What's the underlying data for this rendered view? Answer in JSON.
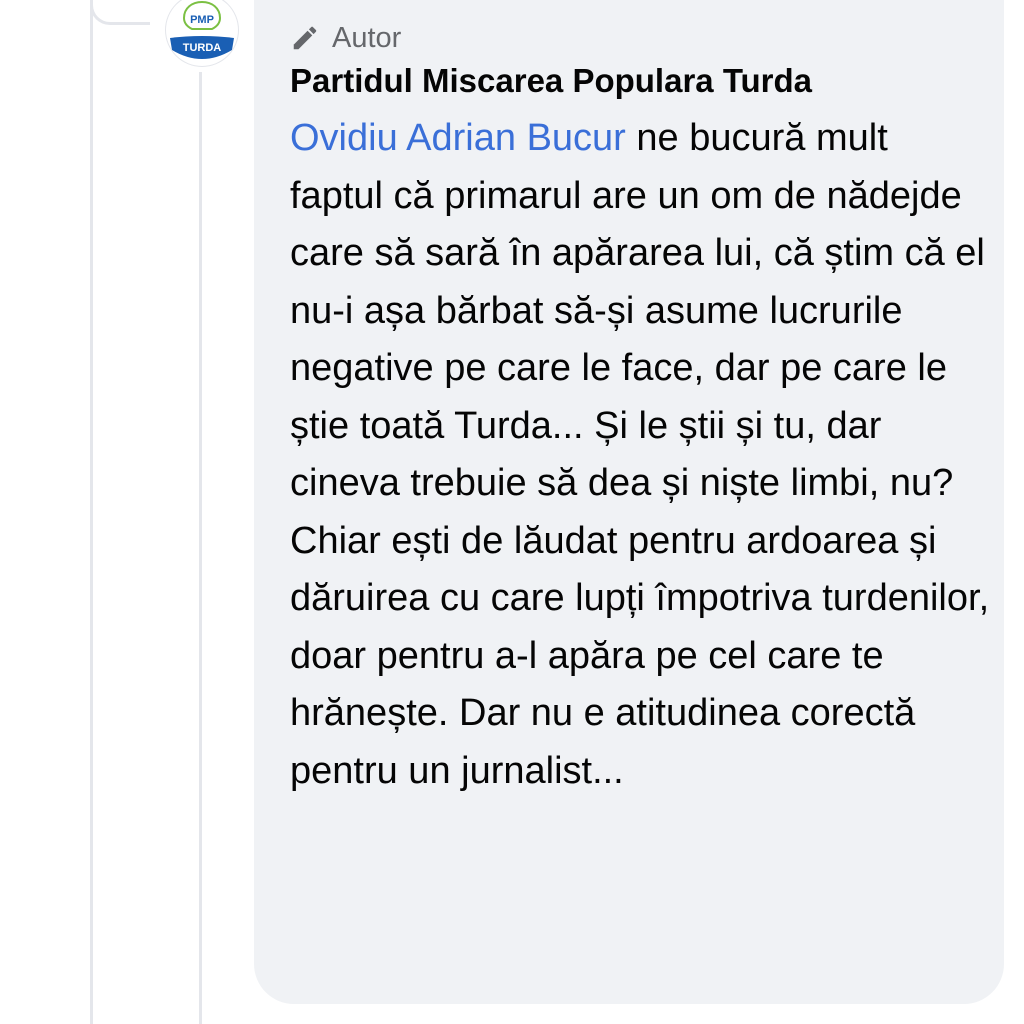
{
  "comment": {
    "author_badge_label": "Autor",
    "author_badge_icon": "pencil-icon",
    "author_name": "Partidul Miscarea Populara Turda",
    "avatar": {
      "top_text": "PMP",
      "bottom_text": "TURDA",
      "ring_color": "#1a5fb4",
      "accent_color": "#7bc043"
    },
    "mention": "Ovidiu Adrian Bucur",
    "text": " ne bucură mult faptul că primarul are un om de nădejde care să sară în apărarea lui, că știm că el nu-i așa bărbat să-și asume lucrurile negative pe care le face, dar pe care le știe toată Turda... Și le știi și tu, dar cineva trebuie să dea și niște limbi, nu? Chiar ești de lăudat pentru ardoarea și dăruirea cu care lupți împotriva turdenilor, doar pentru a-l apăra pe cel care te hrănește. Dar nu e atitudinea corectă pentru un jurnalist..."
  },
  "colors": {
    "bubble_background": "#f0f2f5",
    "mention_link": "#3a6fd8",
    "secondary_text": "#65676b",
    "primary_text": "#050505",
    "thread_line": "#e4e6eb"
  }
}
